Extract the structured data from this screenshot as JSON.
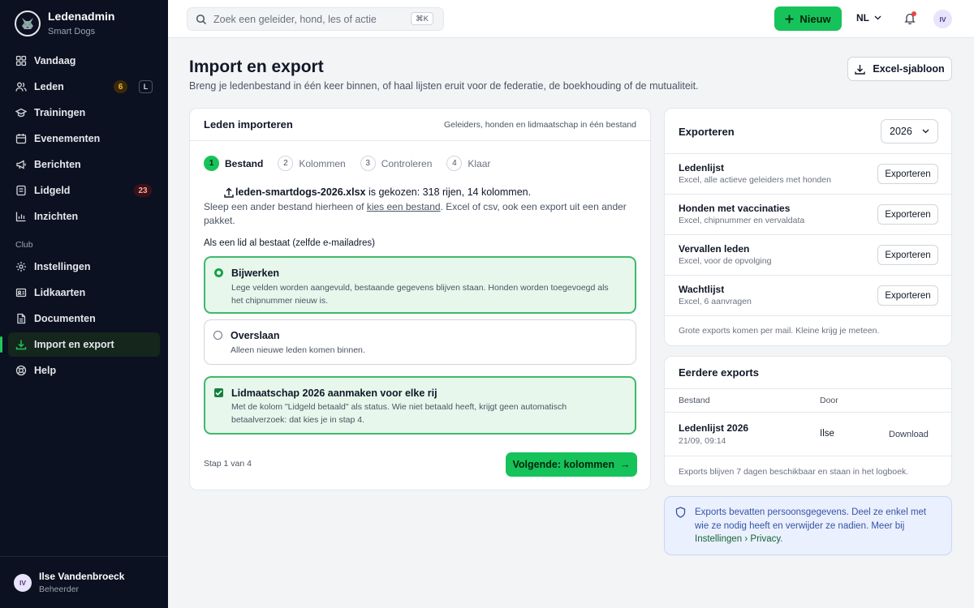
{
  "brand": {
    "title": "Ledenadmin",
    "subtitle": "Smart Dogs"
  },
  "nav": {
    "items": [
      {
        "label": "Vandaag",
        "icon": "grid-icon"
      },
      {
        "label": "Leden",
        "icon": "users-icon",
        "count": "6",
        "kbd": "L"
      },
      {
        "label": "Trainingen",
        "icon": "graduation-cap-icon"
      },
      {
        "label": "Evenementen",
        "icon": "calendar-icon"
      },
      {
        "label": "Berichten",
        "icon": "megaphone-icon"
      },
      {
        "label": "Lidgeld",
        "icon": "wallet-icon",
        "count": "23"
      },
      {
        "label": "Inzichten",
        "icon": "chart-icon"
      }
    ],
    "section_label": "Club",
    "club_items": [
      {
        "label": "Instellingen",
        "icon": "gear-icon"
      },
      {
        "label": "Lidkaarten",
        "icon": "id-card-icon"
      },
      {
        "label": "Documenten",
        "icon": "document-icon"
      },
      {
        "label": "Import en export",
        "icon": "download-icon",
        "active": true
      },
      {
        "label": "Help",
        "icon": "lifebuoy-icon"
      }
    ]
  },
  "user": {
    "initials": "IV",
    "name": "Ilse Vandenbroeck",
    "role": "Beheerder"
  },
  "topbar": {
    "search_placeholder": "Zoek een geleider, hond, les of actie",
    "search_shortcut": "⌘K",
    "new_label": "Nieuw",
    "language": "NL",
    "avatar_initials": "IV"
  },
  "page": {
    "title": "Import en export",
    "subtitle": "Breng je ledenbestand in één keer binnen, of haal lijsten eruit voor de federatie, de boekhouding of de mutualiteit.",
    "template_button": "Excel-sjabloon"
  },
  "import": {
    "title": "Leden importeren",
    "note": "Geleiders, honden en lidmaatschap in één bestand",
    "steps": [
      {
        "num": "1",
        "label": "Bestand",
        "active": true
      },
      {
        "num": "2",
        "label": "Kolommen"
      },
      {
        "num": "3",
        "label": "Controleren"
      },
      {
        "num": "4",
        "label": "Klaar"
      }
    ],
    "file_name": "leden-smartdogs-2026.xlsx",
    "file_info": " is gekozen: 318 rijen, 14 kolommen.",
    "drop_prefix": "Sleep een ander bestand hierheen of ",
    "drop_link": "kies een bestand",
    "drop_suffix": ". Excel of csv, ook een export uit een ander pakket.",
    "exists_label": "Als een lid al bestaat (zelfde e-mailadres)",
    "options": [
      {
        "title": "Bijwerken",
        "desc": "Lege velden worden aangevuld, bestaande gegevens blijven staan. Honden worden toegevoegd als het chipnummer nieuw is.",
        "selected": true
      },
      {
        "title": "Overslaan",
        "desc": "Alleen nieuwe leden komen binnen.",
        "selected": false
      }
    ],
    "membership": {
      "title": "Lidmaatschap 2026 aanmaken voor elke rij",
      "desc": "Met de kolom \"Lidgeld betaald\" als status. Wie niet betaald heeft, krijgt geen automatisch betaalverzoek: dat kies je in stap 4.",
      "checked": true
    },
    "step_count": "Stap 1 van 4",
    "next_label": "Volgende: kolommen",
    "next_arrow": "→"
  },
  "export": {
    "title": "Exporteren",
    "year": "2026",
    "rows": [
      {
        "name": "Ledenlijst",
        "desc": "Excel, alle actieve geleiders met honden",
        "button": "Exporteren"
      },
      {
        "name": "Honden met vaccinaties",
        "desc": "Excel, chipnummer en vervaldata",
        "button": "Exporteren"
      },
      {
        "name": "Vervallen leden",
        "desc": "Excel, voor de opvolging",
        "button": "Exporteren"
      },
      {
        "name": "Wachtlijst",
        "desc": "Excel, 6 aanvragen",
        "button": "Exporteren"
      }
    ],
    "footer": "Grote exports komen per mail. Kleine krijg je meteen."
  },
  "history": {
    "title": "Eerdere exports",
    "col_file": "Bestand",
    "col_by": "Door",
    "rows": [
      {
        "name": "Ledenlijst 2026",
        "date": "21/09, 09:14",
        "by": "Ilse",
        "action": "Download"
      }
    ],
    "footer": "Exports blijven 7 dagen beschikbaar en staan in het logboek."
  },
  "privacy": {
    "text": "Exports bevatten persoonsgegevens. Deel ze enkel met wie ze nodig heeft en verwijder ze nadien. Meer bij ",
    "link": "Instellingen › Privacy",
    "suffix": "."
  },
  "colors": {
    "accent": "#16c35a",
    "sidebar": "#0b1120",
    "selected_bg": "#e7f7ec",
    "info_bg": "#eaf0fe"
  }
}
